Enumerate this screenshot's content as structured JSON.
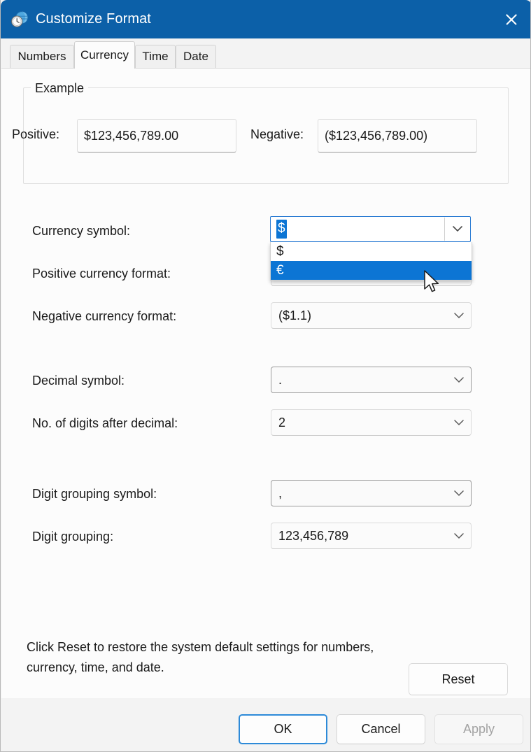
{
  "window": {
    "title": "Customize Format",
    "icon": "region-clock-globe-icon",
    "close_label": "Close",
    "accent_blue": "#0c60a8",
    "highlight_blue": "#0c75d4",
    "focus_blue": "#2d8ad8"
  },
  "tabs": [
    {
      "label": "Numbers",
      "selected": false
    },
    {
      "label": "Currency",
      "selected": true
    },
    {
      "label": "Time",
      "selected": false
    },
    {
      "label": "Date",
      "selected": false
    }
  ],
  "example": {
    "legend": "Example",
    "positive_label": "Positive:",
    "positive_value": "$123,456,789.00",
    "negative_label": "Negative:",
    "negative_value": "($123,456,789.00)"
  },
  "fields": {
    "currency_symbol": {
      "label": "Currency symbol:",
      "value": "$",
      "open": true,
      "options": [
        {
          "label": "$",
          "highlighted": false
        },
        {
          "label": "€",
          "highlighted": true
        }
      ]
    },
    "positive_currency_format": {
      "label": "Positive currency format:",
      "value": ""
    },
    "negative_currency_format": {
      "label": "Negative currency format:",
      "value": "($1.1)"
    },
    "decimal_symbol": {
      "label": "Decimal symbol:",
      "value": "."
    },
    "digits_after_decimal": {
      "label": "No. of digits after decimal:",
      "value": "2"
    },
    "digit_grouping_symbol": {
      "label": "Digit grouping symbol:",
      "value": ","
    },
    "digit_grouping": {
      "label": "Digit grouping:",
      "value": "123,456,789"
    }
  },
  "reset": {
    "description": "Click Reset to restore the system default settings for numbers, currency, time, and date.",
    "button_label": "Reset"
  },
  "footer": {
    "ok_label": "OK",
    "cancel_label": "Cancel",
    "apply_label": "Apply",
    "apply_enabled": false
  }
}
